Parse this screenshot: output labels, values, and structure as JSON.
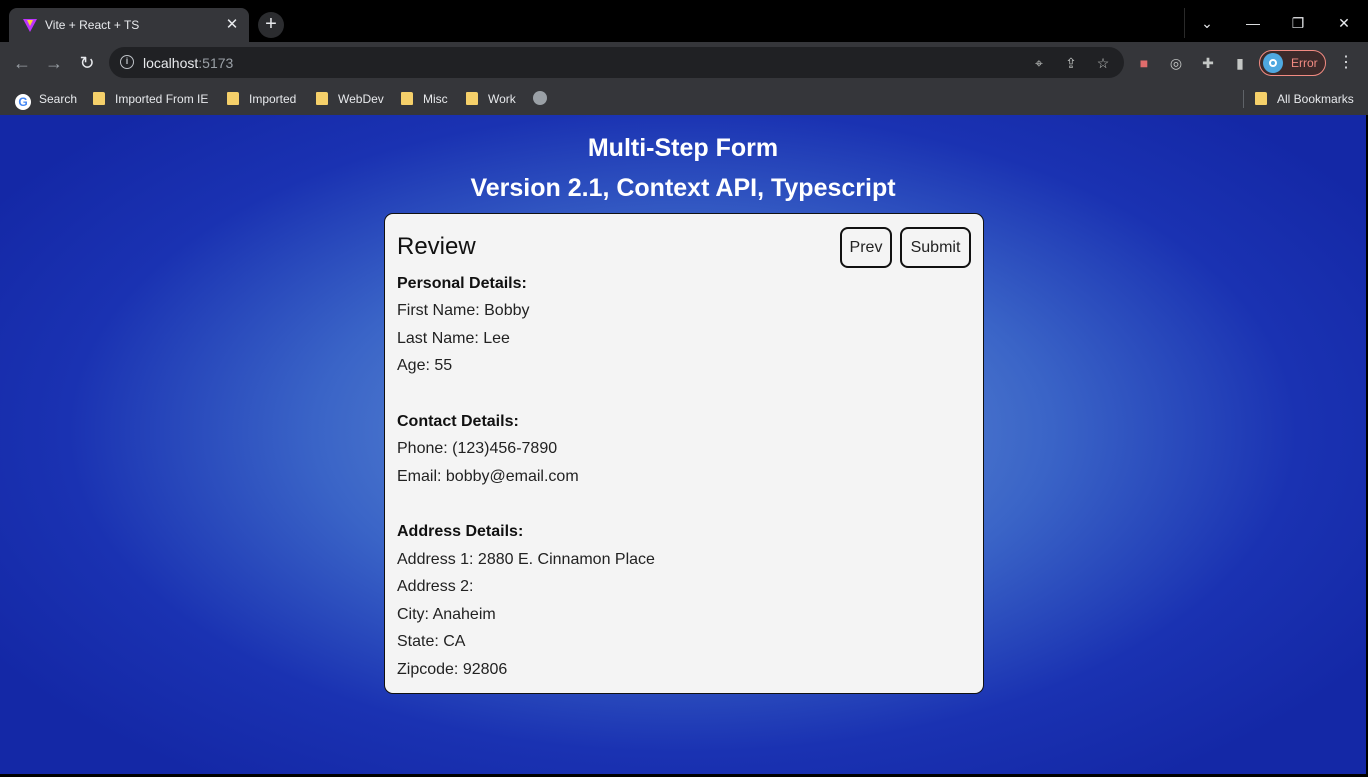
{
  "browser": {
    "tab_title": "Vite + React + TS",
    "url_host": "localhost",
    "url_port": ":5173",
    "profile_label": "Error",
    "bookmarks": [
      {
        "label": "Search",
        "icon": "google-icon"
      },
      {
        "label": "Imported From IE",
        "icon": "folder-icon"
      },
      {
        "label": "Imported",
        "icon": "folder-icon"
      },
      {
        "label": "WebDev",
        "icon": "folder-icon"
      },
      {
        "label": "Misc",
        "icon": "folder-icon"
      },
      {
        "label": "Work",
        "icon": "folder-icon"
      }
    ],
    "all_bookmarks": "All Bookmarks"
  },
  "page": {
    "title": "Multi-Step Form",
    "subtitle": "Version 2.1, Context API, Typescript",
    "card": {
      "title": "Review",
      "prev_label": "Prev",
      "submit_label": "Submit",
      "personal_heading": "Personal Details:",
      "first_name": "First Name: Bobby",
      "last_name": "Last Name: Lee",
      "age": "Age: 55",
      "contact_heading": "Contact Details:",
      "phone": "Phone: (123)456-7890",
      "email": "Email: bobby@email.com",
      "address_heading": "Address Details:",
      "address1": "Address 1: 2880 E. Cinnamon Place",
      "address2": "Address 2:",
      "city": "City: Anaheim",
      "state": "State: CA",
      "zipcode": "Zipcode: 92806"
    }
  },
  "colors": {
    "background_center": "#6c9ad8",
    "background_edge": "#1428a6",
    "card_bg": "#f4f4f4",
    "profile_error": "#f28b82"
  }
}
